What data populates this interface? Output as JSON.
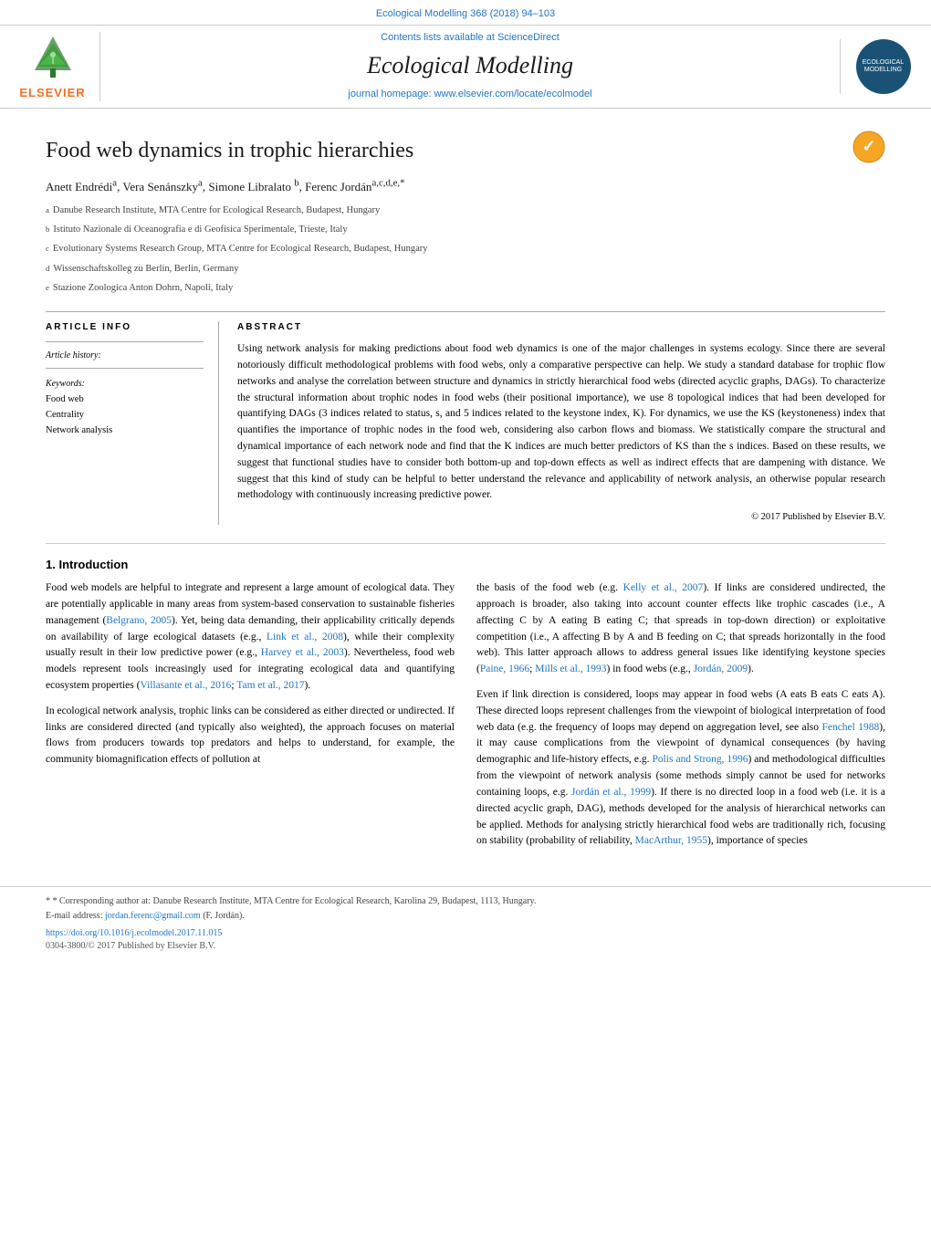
{
  "meta": {
    "journal_ref": "Ecological Modelling 368 (2018) 94–103"
  },
  "header": {
    "contents_text": "Contents lists available at",
    "contents_link": "ScienceDirect",
    "journal_name": "Ecological Modelling",
    "homepage_text": "journal homepage:",
    "homepage_link": "www.elsevier.com/locate/ecolmodel",
    "elsevier_label": "ELSEVIER"
  },
  "article": {
    "title": "Food web dynamics in trophic hierarchies",
    "authors": "Anett Endrédiᵃ, Vera Senánszkyᵃ, Simone Libralato ᵇ, Ferenc JordánᵃⲜᵈᵉ*",
    "affiliations": [
      {
        "sup": "a",
        "text": "Danube Research Institute, MTA Centre for Ecological Research, Budapest, Hungary"
      },
      {
        "sup": "b",
        "text": "Istituto Nazionale di Oceanografia e di Geofisica Sperimentale, Trieste, Italy"
      },
      {
        "sup": "c",
        "text": "Evolutionary Systems Research Group, MTA Centre for Ecological Research, Budapest, Hungary"
      },
      {
        "sup": "d",
        "text": "Wissenschaftskolleg zu Berlin, Berlin, Germany"
      },
      {
        "sup": "e",
        "text": "Stazione Zoologica Anton Dohrn, Napoli, Italy"
      }
    ]
  },
  "article_info": {
    "section_label": "ARTICLE INFO",
    "history_label": "Article history:",
    "keywords_label": "Keywords:",
    "keywords": [
      "Food web",
      "Centrality",
      "Network analysis"
    ]
  },
  "abstract": {
    "section_label": "ABSTRACT",
    "text": "Using network analysis for making predictions about food web dynamics is one of the major challenges in systems ecology. Since there are several notoriously difficult methodological problems with food webs, only a comparative perspective can help. We study a standard database for trophic flow networks and analyse the correlation between structure and dynamics in strictly hierarchical food webs (directed acyclic graphs, DAGs). To characterize the structural information about trophic nodes in food webs (their positional importance), we use 8 topological indices that had been developed for quantifying DAGs (3 indices related to status, s, and 5 indices related to the keystone index, K). For dynamics, we use the KS (keystoneness) index that quantifies the importance of trophic nodes in the food web, considering also carbon flows and biomass. We statistically compare the structural and dynamical importance of each network node and find that the K indices are much better predictors of KS than the s indices. Based on these results, we suggest that functional studies have to consider both bottom-up and top-down effects as well as indirect effects that are dampening with distance. We suggest that this kind of study can be helpful to better understand the relevance and applicability of network analysis, an otherwise popular research methodology with continuously increasing predictive power.",
    "copyright": "© 2017 Published by Elsevier B.V."
  },
  "introduction": {
    "section_number": "1.",
    "section_title": "Introduction",
    "left_paragraphs": [
      "Food web models are helpful to integrate and represent a large amount of ecological data. They are potentially applicable in many areas from system-based conservation to sustainable fisheries management (Belgrano, 2005). Yet, being data demanding, their applicability critically depends on availability of large ecological datasets (e.g., Link et al., 2008), while their complexity usually result in their low predictive power (e.g., Harvey et al., 2003). Nevertheless, food web models represent tools increasingly used for integrating ecological data and quantifying ecosystem properties (Villasante et al., 2016; Tam et al., 2017).",
      "In ecological network analysis, trophic links can be considered as either directed or undirected. If links are considered directed (and typically also weighted), the approach focuses on material flows from producers towards top predators and helps to understand, for example, the community biomagnification effects of pollution at"
    ],
    "right_paragraphs": [
      "the basis of the food web (e.g. Kelly et al., 2007). If links are considered undirected, the approach is broader, also taking into account counter effects like trophic cascades (i.e., A affecting C by A eating B eating C; that spreads in top-down direction) or exploitative competition (i.e., A affecting B by A and B feeding on C; that spreads horizontally in the food web). This latter approach allows to address general issues like identifying keystone species (Paine, 1966; Mills et al., 1993) in food webs (e.g., Jordán, 2009).",
      "Even if link direction is considered, loops may appear in food webs (A eats B eats C eats A). These directed loops represent challenges from the viewpoint of biological interpretation of food web data (e.g. the frequency of loops may depend on aggregation level, see also Fenchel 1988), it may cause complications from the viewpoint of dynamical consequences (by having demographic and life-history effects, e.g. Polis and Strong, 1996) and methodological difficulties from the viewpoint of network analysis (some methods simply cannot be used for networks containing loops, e.g. Jordán et al., 1999). If there is no directed loop in a food web (i.e. it is a directed acyclic graph, DAG), methods developed for the analysis of hierarchical networks can be applied. Methods for analysing strictly hierarchical food webs are traditionally rich, focusing on stability (probability of reliability, MacArthur, 1955), importance of species"
    ]
  },
  "footer": {
    "footnote": "* Corresponding author at: Danube Research Institute, MTA Centre for Ecological Research, Karolina 29, Budapest, 1113, Hungary.",
    "email_label": "E-mail address:",
    "email": "jordan.ferenc@gmail.com",
    "email_suffix": "(F. Jordán).",
    "doi": "https://doi.org/10.1016/j.ecolmodel.2017.11.015",
    "license": "0304-3800/© 2017 Published by Elsevier B.V."
  }
}
